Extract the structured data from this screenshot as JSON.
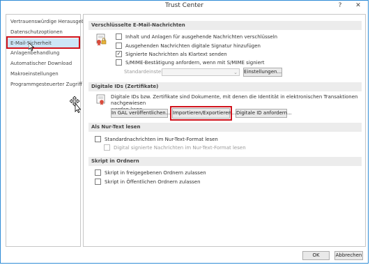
{
  "window": {
    "title": "Trust Center"
  },
  "titlebar": {
    "help_glyph": "?",
    "close_glyph": "✕"
  },
  "sidebar": {
    "items": [
      {
        "label": "Vertrauenswürdige Herausgeber"
      },
      {
        "label": "Datenschutzoptionen"
      },
      {
        "label": "E-Mail-Sicherheit"
      },
      {
        "label": "Anlagenbehandlung"
      },
      {
        "label": "Automatischer Download"
      },
      {
        "label": "Makroeinstellungen"
      },
      {
        "label": "Programmgesteuerter Zugriff"
      }
    ],
    "active_index": 2
  },
  "encrypted": {
    "header": "Verschlüsselte E-Mail-Nachrichten",
    "options": [
      {
        "label": "Inhalt und Anlagen für ausgehende Nachrichten verschlüsseln",
        "checked": false
      },
      {
        "label": "Ausgehenden Nachrichten digitale Signatur hinzufügen",
        "checked": false
      },
      {
        "label": "Signierte Nachrichten als Klartext senden",
        "checked": true
      },
      {
        "label": "S/MIME-Bestätigung anfordern, wenn mit S/MIME signiert",
        "checked": false
      }
    ],
    "default_setting_label": "Standardeinstellung:",
    "settings_button": "Einstellungen...",
    "check_glyph": "✓"
  },
  "digital_ids": {
    "header": "Digitale IDs (Zertifikate)",
    "description_line1": "Digitale IDs bzw. Zertifikate sind Dokumente, mit denen die Identität in elektronischen Transaktionen nachgewiesen",
    "description_line2": "werden kann.",
    "publish_button": "In GAL veröffentlichen...",
    "import_export_button": "Importieren/Exportieren...",
    "request_button": "Digitale ID anfordern..."
  },
  "plain_text": {
    "header": "Als Nur-Text lesen",
    "options": [
      {
        "label": "Standardnachrichten im Nur-Text-Format lesen",
        "checked": false,
        "disabled": false
      },
      {
        "label": "Digital signierte Nachrichten im Nur-Text-Format lesen",
        "checked": false,
        "disabled": true
      }
    ]
  },
  "script_folders": {
    "header": "Skript in Ordnern",
    "options": [
      {
        "label": "Skript in freigegebenen Ordnern zulassen",
        "checked": false
      },
      {
        "label": "Skript in Öffentlichen Ordnern zulassen",
        "checked": false
      }
    ]
  },
  "footer": {
    "ok_label": "OK",
    "cancel_label": "Abbrechen"
  },
  "colors": {
    "accent": "#2e8bd6",
    "highlight": "#d0121b",
    "selected": "#cde6f7"
  }
}
